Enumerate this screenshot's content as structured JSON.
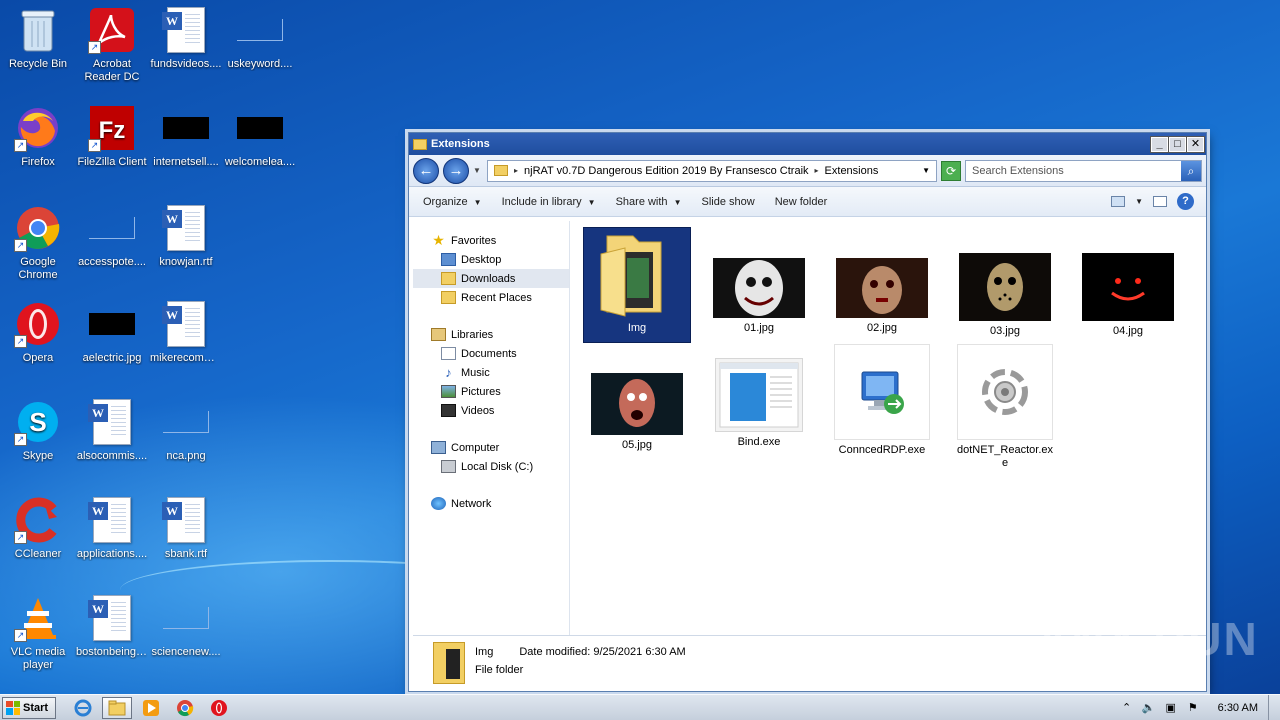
{
  "desktop": {
    "icons": [
      {
        "label": "Recycle Bin",
        "icon": "recycle-bin-icon"
      },
      {
        "label": "Acrobat Reader DC",
        "icon": "acrobat-icon"
      },
      {
        "label": "fundsvideos....",
        "icon": "word-doc-icon"
      },
      {
        "label": "uskeyword....",
        "icon": "blank-file-icon"
      },
      {
        "label": "Firefox",
        "icon": "firefox-icon"
      },
      {
        "label": "FileZilla Client",
        "icon": "filezilla-icon"
      },
      {
        "label": "internetsell....",
        "icon": "black-file-icon"
      },
      {
        "label": "welcomelea....",
        "icon": "black-file-icon"
      },
      {
        "label": "Google Chrome",
        "icon": "chrome-icon"
      },
      {
        "label": "accesspote....",
        "icon": "blank-file-icon"
      },
      {
        "label": "knowjan.rtf",
        "icon": "word-doc-icon"
      },
      {
        "label": "Opera",
        "icon": "opera-icon"
      },
      {
        "label": "aelectric.jpg",
        "icon": "black-file-icon"
      },
      {
        "label": "mikerecomm....",
        "icon": "word-doc-icon"
      },
      {
        "label": "Skype",
        "icon": "skype-icon"
      },
      {
        "label": "alsocommis....",
        "icon": "word-doc-icon"
      },
      {
        "label": "nca.png",
        "icon": "blank-file-icon"
      },
      {
        "label": "CCleaner",
        "icon": "ccleaner-icon"
      },
      {
        "label": "applications....",
        "icon": "word-doc-icon"
      },
      {
        "label": "sbank.rtf",
        "icon": "word-doc-icon"
      },
      {
        "label": "VLC media player",
        "icon": "vlc-icon"
      },
      {
        "label": "bostonbeing....",
        "icon": "word-doc-icon"
      },
      {
        "label": "sciencenew....",
        "icon": "blank-file-icon"
      }
    ]
  },
  "window": {
    "title": "Extensions",
    "controls": {
      "minimize": "_",
      "maximize": "□",
      "close": "✕"
    },
    "breadcrumb": [
      "njRAT v0.7D Dangerous Edition 2019 By Fransesco Ctraik",
      "Extensions"
    ],
    "search_placeholder": "Search Extensions",
    "toolbar": {
      "organize": "Organize",
      "include_in_library": "Include in library",
      "share_with": "Share with",
      "slide_show": "Slide show",
      "new_folder": "New folder"
    },
    "nav": {
      "favorites": "Favorites",
      "desktop": "Desktop",
      "downloads": "Downloads",
      "recent_places": "Recent Places",
      "libraries": "Libraries",
      "documents": "Documents",
      "music": "Music",
      "pictures": "Pictures",
      "videos": "Videos",
      "computer": "Computer",
      "local_disk": "Local Disk (C:)",
      "network": "Network"
    },
    "files": [
      {
        "name": "Img",
        "kind": "folder",
        "selected": true
      },
      {
        "name": "01.jpg",
        "kind": "image"
      },
      {
        "name": "02.jpg",
        "kind": "image"
      },
      {
        "name": "03.jpg",
        "kind": "image"
      },
      {
        "name": "04.jpg",
        "kind": "image"
      },
      {
        "name": "05.jpg",
        "kind": "image"
      },
      {
        "name": "Bind.exe",
        "kind": "exe"
      },
      {
        "name": "ConncedRDP.exe",
        "kind": "exe"
      },
      {
        "name": "dotNET_Reactor.exe",
        "kind": "exe"
      }
    ],
    "details": {
      "name": "Img",
      "date_label": "Date modified:",
      "date_value": "9/25/2021 6:30 AM",
      "type": "File folder"
    }
  },
  "taskbar": {
    "start": "Start",
    "clock": "6:30 AM"
  },
  "watermark": "ANY RUN",
  "colors": {
    "selection": "#16357f",
    "titlebar": "#2f5fb4"
  }
}
